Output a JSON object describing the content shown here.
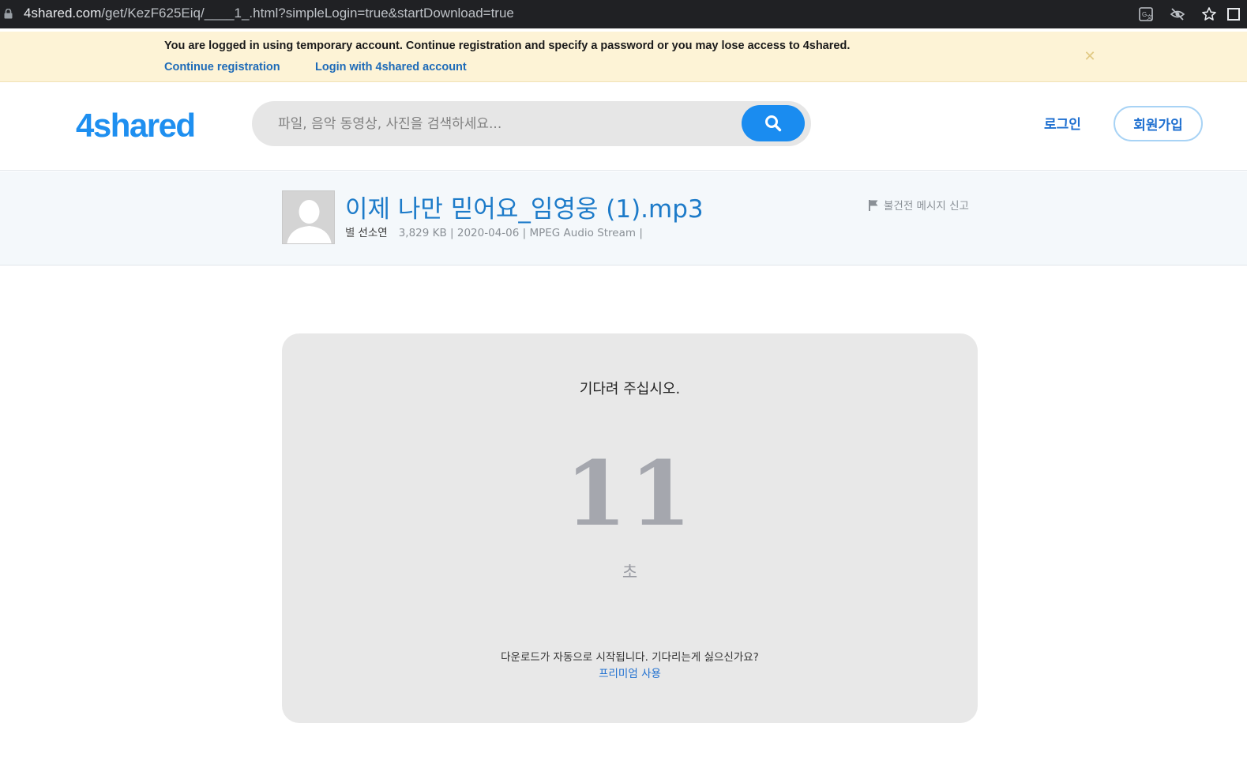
{
  "browser": {
    "url_host": "4shared.com",
    "url_path": "/get/KezF625Eiq/____1_.html?simpleLogin=true&startDownload=true",
    "icons": [
      "lock-icon",
      "translate-icon",
      "eye-off-icon",
      "star-icon",
      "window-icon"
    ]
  },
  "banner": {
    "message": "You are logged in using temporary account. Continue registration and specify a password or you may lose access to 4shared.",
    "continue_link": "Continue registration",
    "login_link": "Login with 4shared account",
    "close_symbol": "✕"
  },
  "header": {
    "logo": "4shared",
    "search_placeholder": "파일, 음악 동영상, 사진을 검색하세요...",
    "login_label": "로그인",
    "signup_label": "회원가입",
    "brand_color": "#1a8cf0"
  },
  "file": {
    "title": "이제 나만 믿어요_임영웅 (1).mp3",
    "by_label": "별",
    "owner": "선소연",
    "meta": "3,829 KB | 2020-04-06 | MPEG Audio Stream |",
    "report_label": "불건전 메시지 신고"
  },
  "download": {
    "wait_text": "기다려 주십시오.",
    "countdown": "11",
    "seconds_label": "초",
    "auto_text": "다운로드가 자동으로 시작됩니다. 기다리는게 싫으신가요?",
    "premium_link": "프리미엄 사용"
  }
}
